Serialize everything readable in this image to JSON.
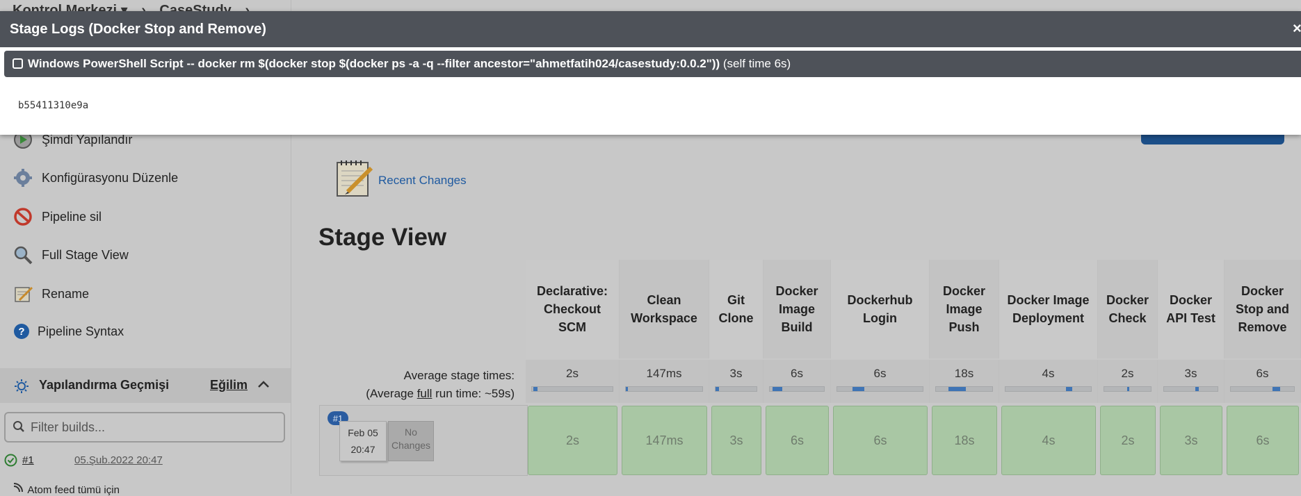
{
  "breadcrumb": {
    "items": [
      "Kontrol Merkezi ▾",
      "›",
      "CaseStudy",
      "›"
    ]
  },
  "sidebar": {
    "items": [
      {
        "label": "Şimdi Yapılandır",
        "icon": "play-clock-icon"
      },
      {
        "label": "Konfigürasyonu Düzenle",
        "icon": "gear-icon"
      },
      {
        "label": "Pipeline sil",
        "icon": "no-entry-icon"
      },
      {
        "label": "Full Stage View",
        "icon": "magnifier-icon"
      },
      {
        "label": "Rename",
        "icon": "notepad-icon"
      },
      {
        "label": "Pipeline Syntax",
        "icon": "help-icon"
      }
    ],
    "history": {
      "title": "Yapılandırma Geçmişi",
      "trend": "Eğilim",
      "filter_placeholder": "Filter builds..."
    },
    "builds": [
      {
        "number": "#1",
        "date": "05.Şub.2022 20:47"
      }
    ],
    "atom": "Atom feed tümü için"
  },
  "main": {
    "recent_changes": "Recent Changes",
    "stage_view_title": "Stage View",
    "avg_stage_label": "Average stage times:",
    "avg_run_prefix": "(Average ",
    "avg_run_full": "full",
    "avg_run_suffix": " run time: ~59s)",
    "stages": [
      {
        "name": "Declarative: Checkout SCM",
        "avg": "2s",
        "run": "2s",
        "fill": 0.05
      },
      {
        "name": "Clean Workspace",
        "avg": "147ms",
        "run": "147ms",
        "fill": 0.01
      },
      {
        "name": "Git Clone",
        "avg": "3s",
        "run": "3s",
        "fill": 0.08
      },
      {
        "name": "Docker Image Build",
        "avg": "6s",
        "run": "6s",
        "fill": 0.18
      },
      {
        "name": "Dockerhub Login",
        "avg": "6s",
        "run": "6s",
        "fill": 0.14
      },
      {
        "name": "Docker Image Push",
        "avg": "18s",
        "run": "18s",
        "fill": 0.3
      },
      {
        "name": "Docker Image Deployment",
        "avg": "4s",
        "run": "4s",
        "fill": 0.07
      },
      {
        "name": "Docker Check",
        "avg": "2s",
        "run": "2s",
        "fill": 0.05
      },
      {
        "name": "Docker API Test",
        "avg": "3s",
        "run": "3s",
        "fill": 0.06
      },
      {
        "name": "Docker Stop and Remove",
        "avg": "6s",
        "run": "6s",
        "fill": 0.12
      }
    ],
    "run": {
      "badge": "#1",
      "date": "Feb 05",
      "time": "20:47",
      "changes": "No Changes"
    }
  },
  "modal": {
    "title": "Stage Logs (Docker Stop and Remove)",
    "close": "×",
    "step_label": "Windows PowerShell Script -- docker rm $(docker stop $(docker ps -a -q --filter ancestor=\"ahmetfatih024/casestudy:0.0.2\"))",
    "step_time": "(self time 6s)",
    "output": "b55411310e9a"
  },
  "colors": {
    "accent": "#1f5aa0",
    "success_cell": "#a9c7a4",
    "modal_header": "#4e5259",
    "bar_fill": "#3f74b5"
  }
}
